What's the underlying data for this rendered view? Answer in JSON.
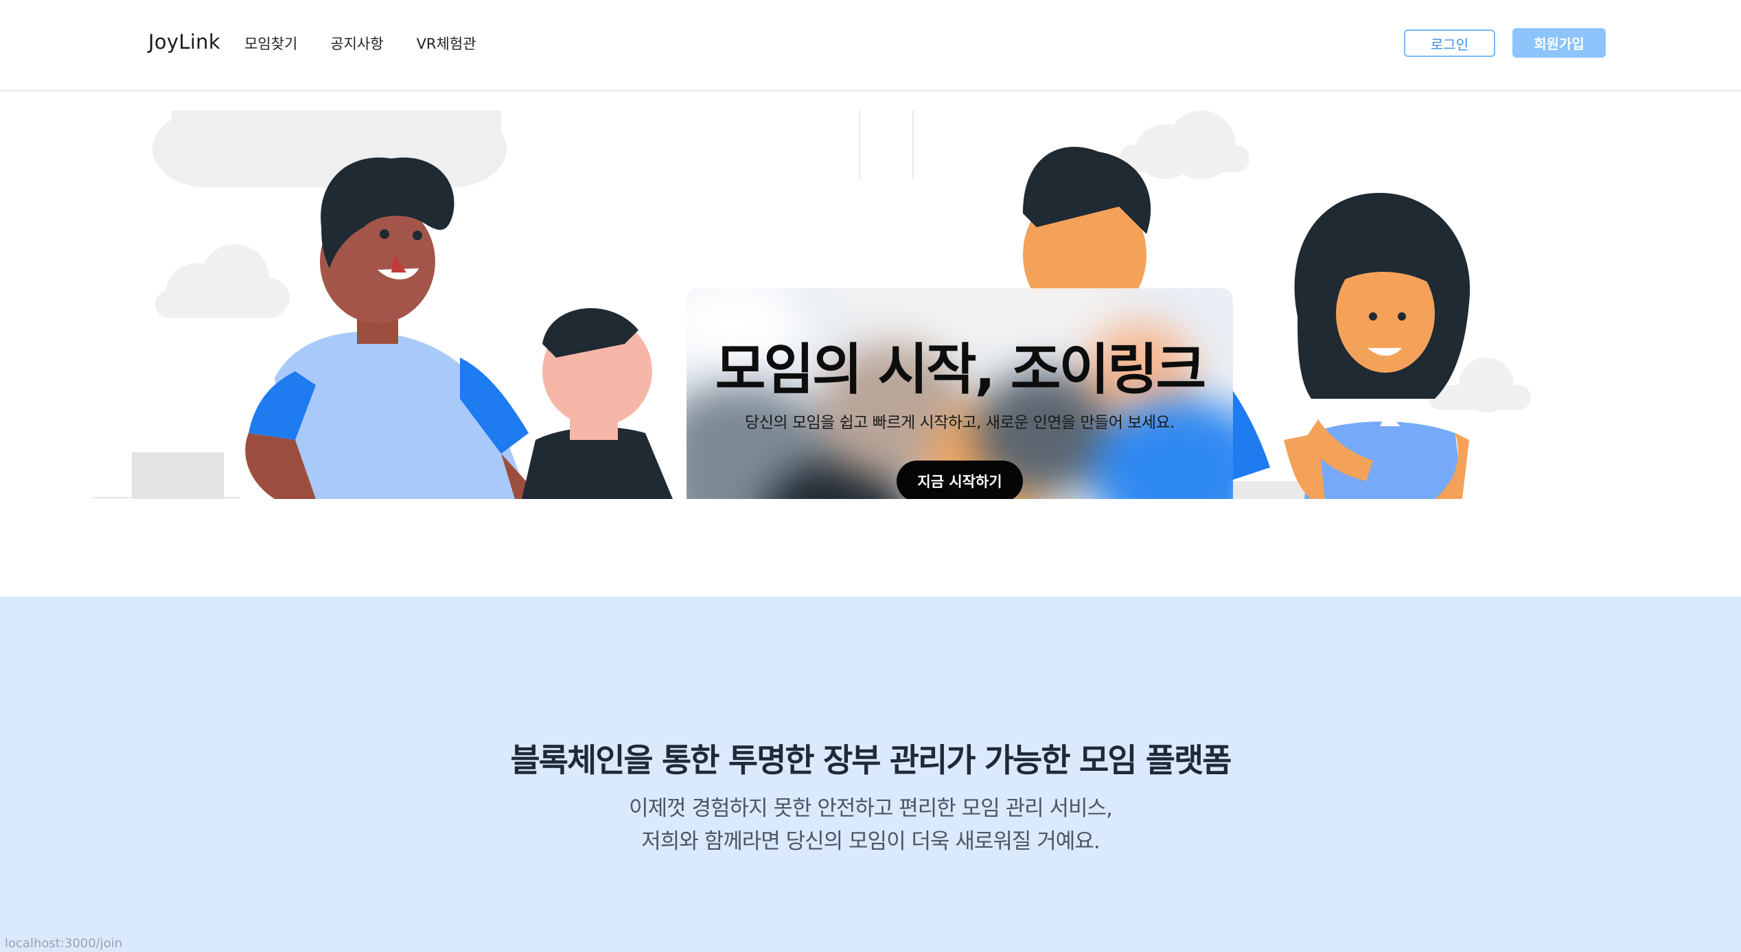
{
  "header": {
    "logo": "JoyLink",
    "nav": [
      "모임찾기",
      "공지사항",
      "VR체험관"
    ],
    "login_label": "로그인",
    "signup_label": "회원가입"
  },
  "hero": {
    "title": "모임의 시작, 조이링크",
    "subtitle": "당신의 모임을 쉽고 빠르게 시작하고, 새로운 인연을 만들어 보세요.",
    "cta_label": "지금 시작하기"
  },
  "feature": {
    "title": "블록체인을 통한 투명한 장부 관리가 가능한 모임 플랫폼",
    "desc_line1": "이제껏 경험하지 못한 안전하고 편리한 모임 관리 서비스,",
    "desc_line2": "저희와 함께라면 당신의 모임이 더욱 새로워질 거예요."
  },
  "status_url": "localhost:3000/join",
  "colors": {
    "accent": "#8cc4fb",
    "login_border": "#7ab8f5",
    "feature_bg": "#dbe9fd",
    "illustration_blue": "#1e7bf0",
    "illustration_dark": "#1f2a33"
  }
}
